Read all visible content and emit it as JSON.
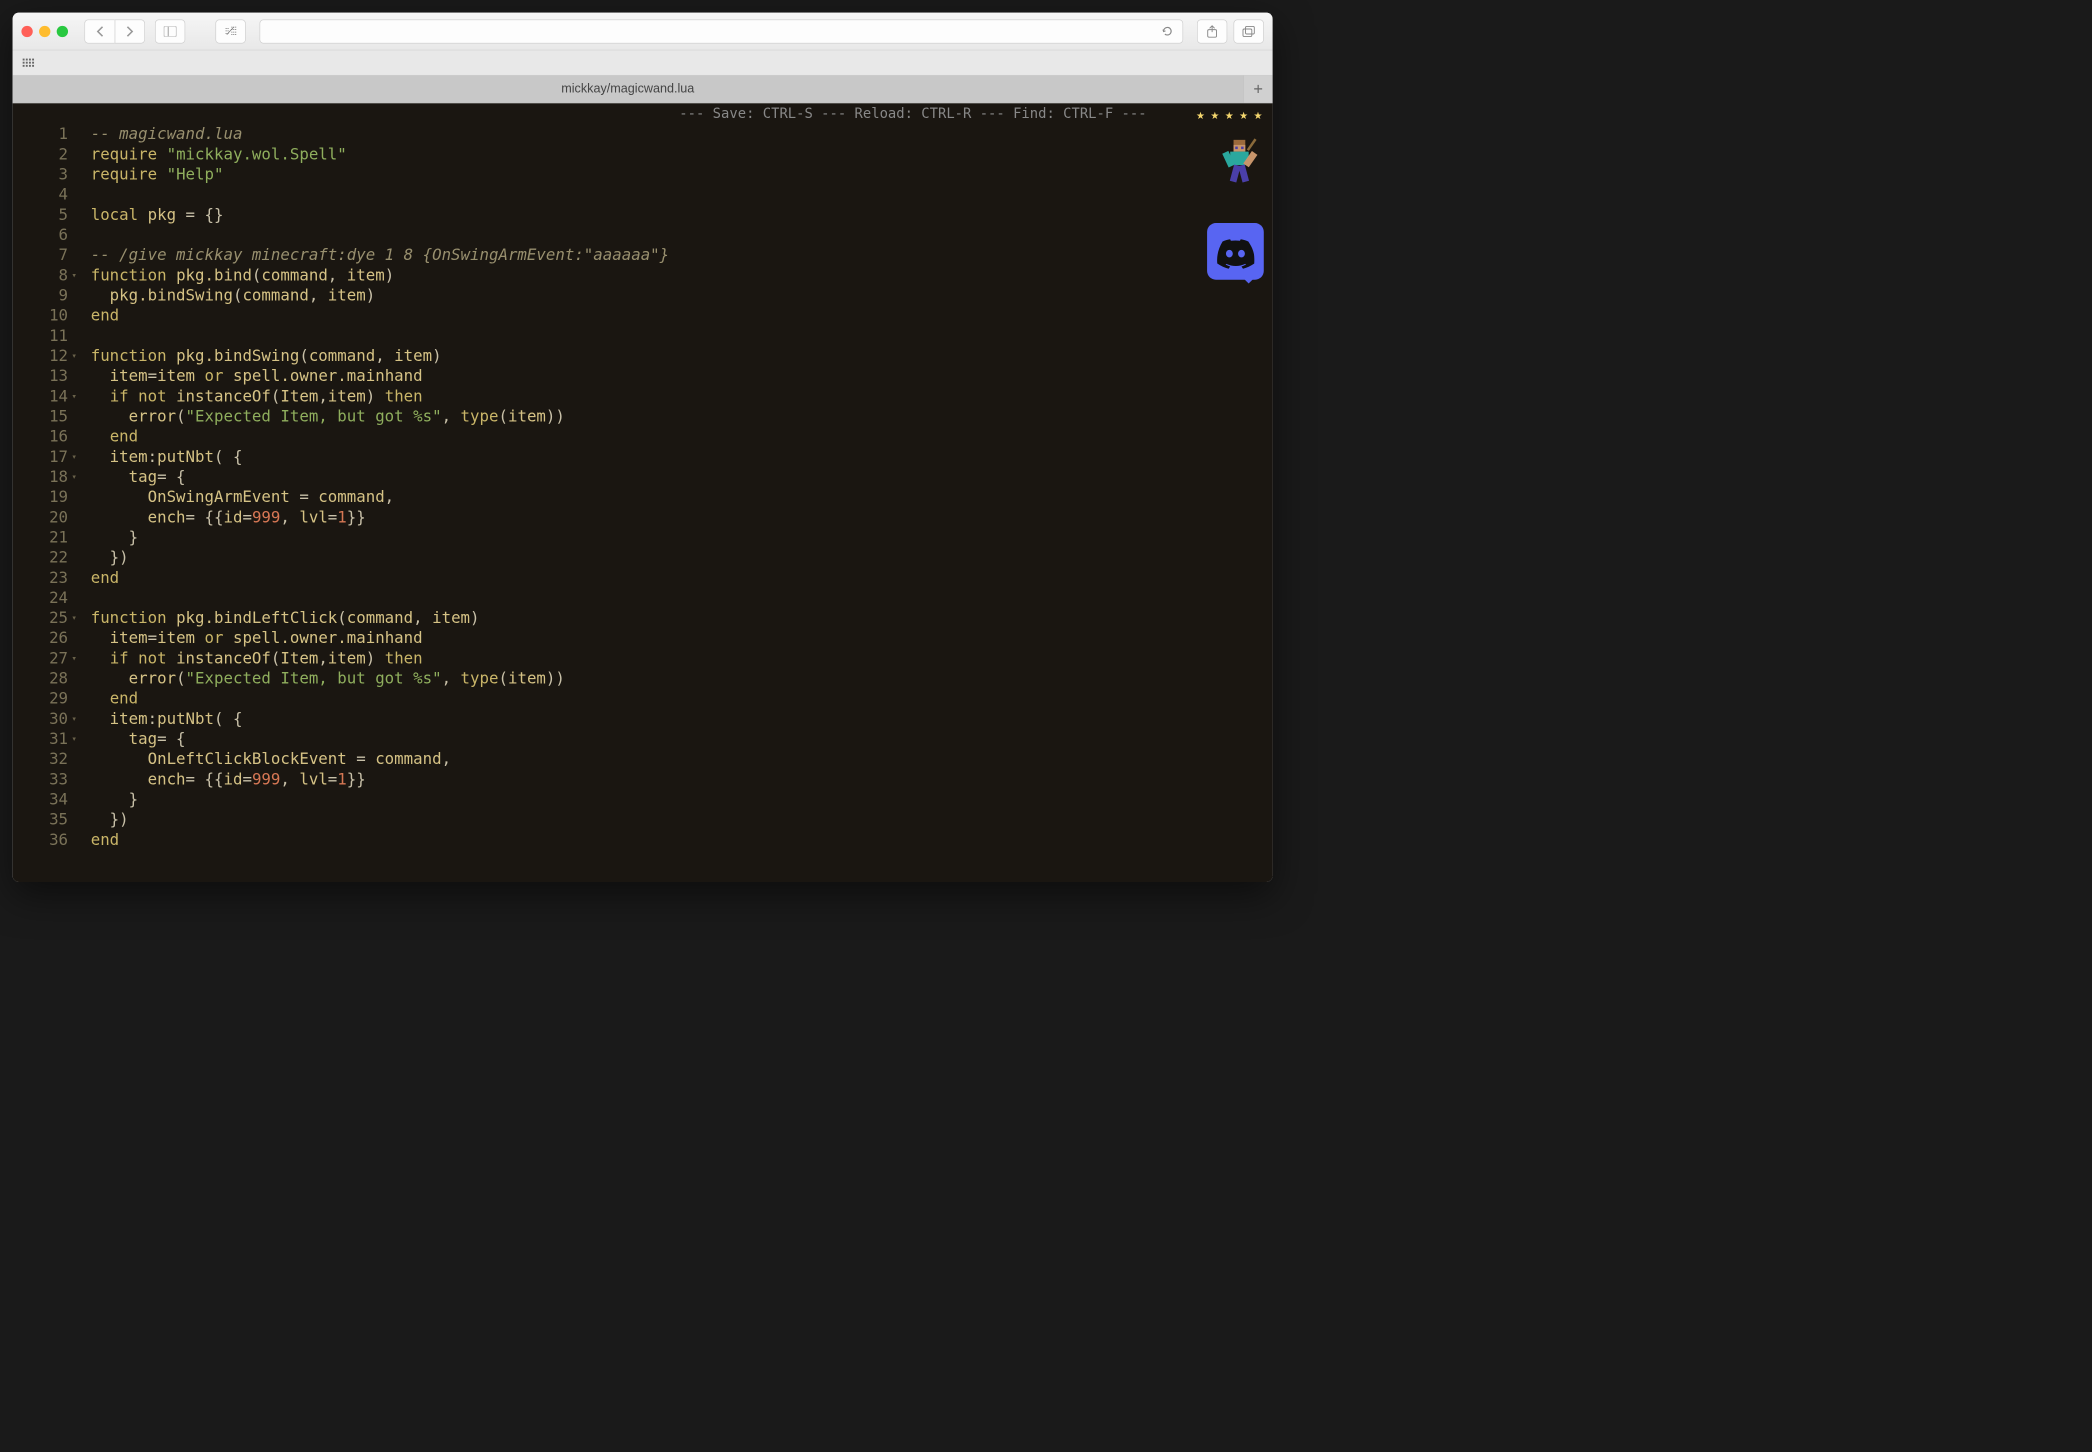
{
  "tab_title": "mickkay/magicwand.lua",
  "hint_bar": "--- Save: CTRL-S --- Reload: CTRL-R --- Find: CTRL-F ---",
  "icons": {
    "close": "close-icon",
    "minimize": "minimize-icon",
    "maximize": "maximize-icon",
    "back": "chevron-left-icon",
    "forward": "chevron-right-icon",
    "sidebar": "sidebar-icon",
    "reader": "reader-icon",
    "reload": "reload-icon",
    "share": "share-icon",
    "tabs": "tabs-icon",
    "grid": "apps-grid-icon",
    "plus": "plus-icon",
    "steve": "minecraft-character-icon",
    "discord": "discord-icon"
  },
  "code_lines": [
    {
      "n": 1,
      "fold": false,
      "tokens": [
        [
          "-- magicwand.lua",
          "comment"
        ]
      ]
    },
    {
      "n": 2,
      "fold": false,
      "tokens": [
        [
          "require ",
          "keyword"
        ],
        [
          "\"mickkay.wol.Spell\"",
          "string"
        ]
      ]
    },
    {
      "n": 3,
      "fold": false,
      "tokens": [
        [
          "require ",
          "keyword"
        ],
        [
          "\"Help\"",
          "string"
        ]
      ]
    },
    {
      "n": 4,
      "fold": false,
      "tokens": [
        [
          "",
          ""
        ]
      ]
    },
    {
      "n": 5,
      "fold": false,
      "tokens": [
        [
          "local ",
          "keyword"
        ],
        [
          "pkg ",
          "ident"
        ],
        [
          "= {}",
          "punct"
        ]
      ]
    },
    {
      "n": 6,
      "fold": false,
      "tokens": [
        [
          "",
          ""
        ]
      ]
    },
    {
      "n": 7,
      "fold": false,
      "tokens": [
        [
          "-- /give mickkay minecraft:dye 1 8 {OnSwingArmEvent:\"aaaaaa\"}",
          "comment"
        ]
      ]
    },
    {
      "n": 8,
      "fold": true,
      "tokens": [
        [
          "function ",
          "keyword"
        ],
        [
          "pkg.bind",
          "ident"
        ],
        [
          "(",
          "punct"
        ],
        [
          "command",
          "ident"
        ],
        [
          ", ",
          "punct"
        ],
        [
          "item",
          "ident"
        ],
        [
          ")",
          "punct"
        ]
      ]
    },
    {
      "n": 9,
      "fold": false,
      "tokens": [
        [
          "  pkg.bindSwing",
          "ident"
        ],
        [
          "(",
          "punct"
        ],
        [
          "command",
          "ident"
        ],
        [
          ", ",
          "punct"
        ],
        [
          "item",
          "ident"
        ],
        [
          ")",
          "punct"
        ]
      ]
    },
    {
      "n": 10,
      "fold": false,
      "tokens": [
        [
          "end",
          "keyword"
        ]
      ]
    },
    {
      "n": 11,
      "fold": false,
      "tokens": [
        [
          "",
          ""
        ]
      ]
    },
    {
      "n": 12,
      "fold": true,
      "tokens": [
        [
          "function ",
          "keyword"
        ],
        [
          "pkg.bindSwing",
          "ident"
        ],
        [
          "(",
          "punct"
        ],
        [
          "command",
          "ident"
        ],
        [
          ", ",
          "punct"
        ],
        [
          "item",
          "ident"
        ],
        [
          ")",
          "punct"
        ]
      ]
    },
    {
      "n": 13,
      "fold": false,
      "tokens": [
        [
          "  item",
          "ident"
        ],
        [
          "=",
          "punct"
        ],
        [
          "item ",
          "ident"
        ],
        [
          "or ",
          "keyword"
        ],
        [
          "spell.owner.mainhand",
          "ident"
        ]
      ]
    },
    {
      "n": 14,
      "fold": true,
      "tokens": [
        [
          "  ",
          "punct"
        ],
        [
          "if not ",
          "keyword"
        ],
        [
          "instanceOf",
          "ident"
        ],
        [
          "(",
          "punct"
        ],
        [
          "Item",
          "ident"
        ],
        [
          ",",
          "punct"
        ],
        [
          "item",
          "ident"
        ],
        [
          ") ",
          "punct"
        ],
        [
          "then",
          "keyword"
        ]
      ]
    },
    {
      "n": 15,
      "fold": false,
      "tokens": [
        [
          "    error",
          "ident"
        ],
        [
          "(",
          "punct"
        ],
        [
          "\"Expected Item, but got %s\"",
          "string"
        ],
        [
          ", ",
          "punct"
        ],
        [
          "type",
          "keyword"
        ],
        [
          "(",
          "punct"
        ],
        [
          "item",
          "ident"
        ],
        [
          "))",
          "punct"
        ]
      ]
    },
    {
      "n": 16,
      "fold": false,
      "tokens": [
        [
          "  ",
          "punct"
        ],
        [
          "end",
          "keyword"
        ]
      ]
    },
    {
      "n": 17,
      "fold": true,
      "tokens": [
        [
          "  item",
          "ident"
        ],
        [
          ":",
          "punct"
        ],
        [
          "putNbt",
          "ident"
        ],
        [
          "( {",
          "punct"
        ]
      ]
    },
    {
      "n": 18,
      "fold": true,
      "tokens": [
        [
          "    tag",
          "ident"
        ],
        [
          "= {",
          "punct"
        ]
      ]
    },
    {
      "n": 19,
      "fold": false,
      "tokens": [
        [
          "      OnSwingArmEvent ",
          "ident"
        ],
        [
          "= ",
          "punct"
        ],
        [
          "command",
          "ident"
        ],
        [
          ",",
          "punct"
        ]
      ]
    },
    {
      "n": 20,
      "fold": false,
      "tokens": [
        [
          "      ench",
          "ident"
        ],
        [
          "= {{",
          "punct"
        ],
        [
          "id",
          "ident"
        ],
        [
          "=",
          "punct"
        ],
        [
          "999",
          "number"
        ],
        [
          ", ",
          "punct"
        ],
        [
          "lvl",
          "ident"
        ],
        [
          "=",
          "punct"
        ],
        [
          "1",
          "number"
        ],
        [
          "}}",
          "punct"
        ]
      ]
    },
    {
      "n": 21,
      "fold": false,
      "tokens": [
        [
          "    }",
          "punct"
        ]
      ]
    },
    {
      "n": 22,
      "fold": false,
      "tokens": [
        [
          "  })",
          "punct"
        ]
      ]
    },
    {
      "n": 23,
      "fold": false,
      "tokens": [
        [
          "end",
          "keyword"
        ]
      ]
    },
    {
      "n": 24,
      "fold": false,
      "tokens": [
        [
          "",
          ""
        ]
      ]
    },
    {
      "n": 25,
      "fold": true,
      "tokens": [
        [
          "function ",
          "keyword"
        ],
        [
          "pkg.bindLeftClick",
          "ident"
        ],
        [
          "(",
          "punct"
        ],
        [
          "command",
          "ident"
        ],
        [
          ", ",
          "punct"
        ],
        [
          "item",
          "ident"
        ],
        [
          ")",
          "punct"
        ]
      ]
    },
    {
      "n": 26,
      "fold": false,
      "tokens": [
        [
          "  item",
          "ident"
        ],
        [
          "=",
          "punct"
        ],
        [
          "item ",
          "ident"
        ],
        [
          "or ",
          "keyword"
        ],
        [
          "spell.owner.mainhand",
          "ident"
        ]
      ]
    },
    {
      "n": 27,
      "fold": true,
      "tokens": [
        [
          "  ",
          "punct"
        ],
        [
          "if not ",
          "keyword"
        ],
        [
          "instanceOf",
          "ident"
        ],
        [
          "(",
          "punct"
        ],
        [
          "Item",
          "ident"
        ],
        [
          ",",
          "punct"
        ],
        [
          "item",
          "ident"
        ],
        [
          ") ",
          "punct"
        ],
        [
          "then",
          "keyword"
        ]
      ]
    },
    {
      "n": 28,
      "fold": false,
      "tokens": [
        [
          "    error",
          "ident"
        ],
        [
          "(",
          "punct"
        ],
        [
          "\"Expected Item, but got %s\"",
          "string"
        ],
        [
          ", ",
          "punct"
        ],
        [
          "type",
          "keyword"
        ],
        [
          "(",
          "punct"
        ],
        [
          "item",
          "ident"
        ],
        [
          "))",
          "punct"
        ]
      ]
    },
    {
      "n": 29,
      "fold": false,
      "tokens": [
        [
          "  ",
          "punct"
        ],
        [
          "end",
          "keyword"
        ]
      ]
    },
    {
      "n": 30,
      "fold": true,
      "tokens": [
        [
          "  item",
          "ident"
        ],
        [
          ":",
          "punct"
        ],
        [
          "putNbt",
          "ident"
        ],
        [
          "( {",
          "punct"
        ]
      ]
    },
    {
      "n": 31,
      "fold": true,
      "tokens": [
        [
          "    tag",
          "ident"
        ],
        [
          "= {",
          "punct"
        ]
      ]
    },
    {
      "n": 32,
      "fold": false,
      "tokens": [
        [
          "      OnLeftClickBlockEvent ",
          "ident"
        ],
        [
          "= ",
          "punct"
        ],
        [
          "command",
          "ident"
        ],
        [
          ",",
          "punct"
        ]
      ]
    },
    {
      "n": 33,
      "fold": false,
      "tokens": [
        [
          "      ench",
          "ident"
        ],
        [
          "= {{",
          "punct"
        ],
        [
          "id",
          "ident"
        ],
        [
          "=",
          "punct"
        ],
        [
          "999",
          "number"
        ],
        [
          ", ",
          "punct"
        ],
        [
          "lvl",
          "ident"
        ],
        [
          "=",
          "punct"
        ],
        [
          "1",
          "number"
        ],
        [
          "}}",
          "punct"
        ]
      ]
    },
    {
      "n": 34,
      "fold": false,
      "tokens": [
        [
          "    }",
          "punct"
        ]
      ]
    },
    {
      "n": 35,
      "fold": false,
      "tokens": [
        [
          "  })",
          "punct"
        ]
      ]
    },
    {
      "n": 36,
      "fold": false,
      "tokens": [
        [
          "end",
          "keyword"
        ]
      ]
    }
  ]
}
